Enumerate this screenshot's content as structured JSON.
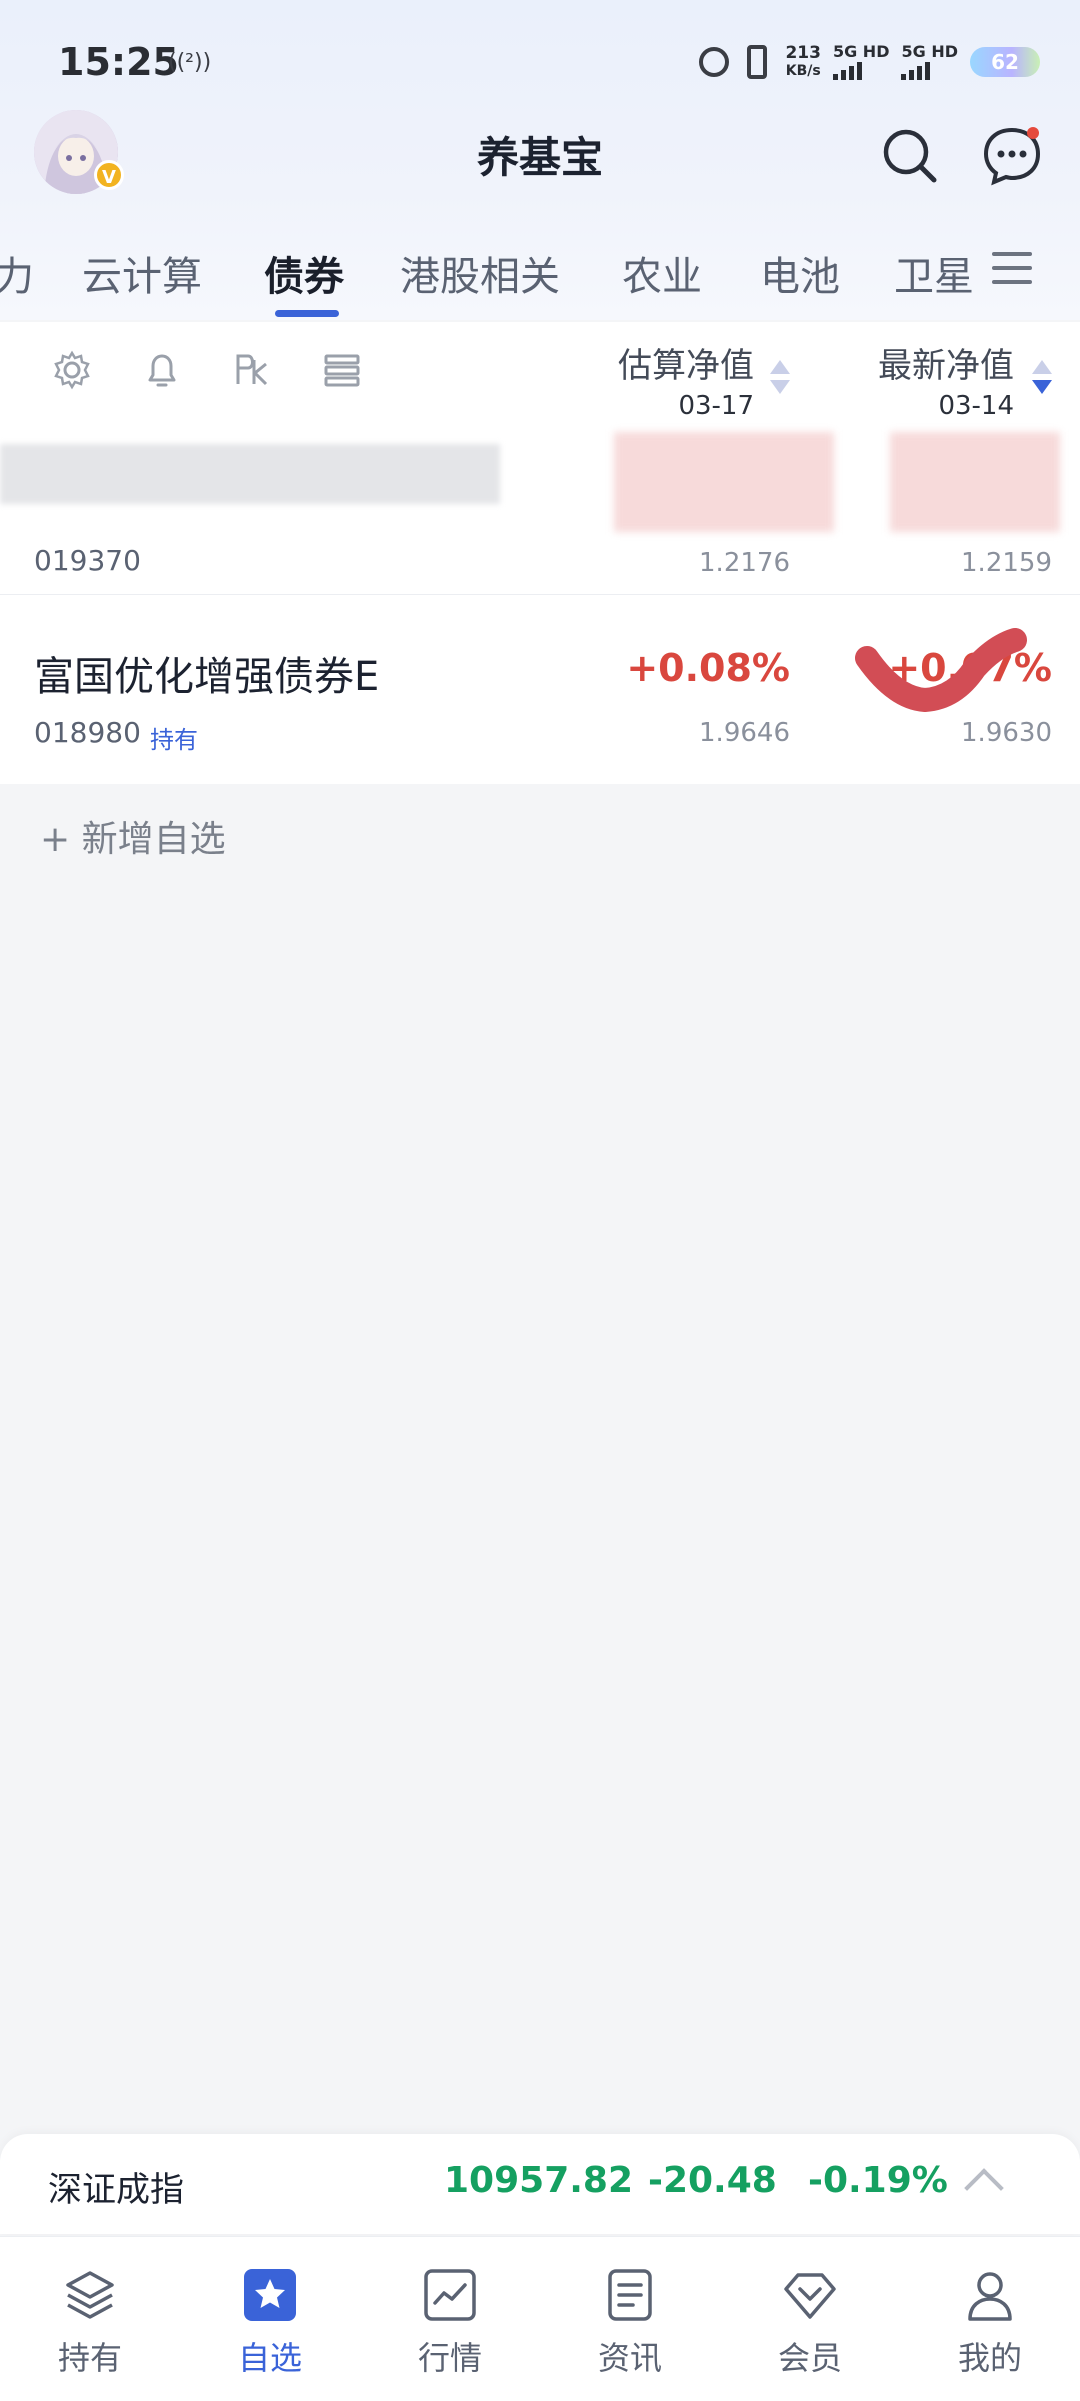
{
  "status_bar": {
    "time": "15:25",
    "signal_label": "((²))",
    "speed_value": "213",
    "speed_unit": "KB/s",
    "net1": "5G HD",
    "net2": "5G HD",
    "battery": "62"
  },
  "header": {
    "title": "养基宝",
    "avatar_badge": "V"
  },
  "tabs": {
    "items": [
      "力",
      "云计算",
      "债券",
      "港股相关",
      "农业",
      "电池",
      "卫星"
    ],
    "active": "债券"
  },
  "table_header": {
    "est_label": "估算净值",
    "est_date": "03-17",
    "last_label": "最新净值",
    "last_date": "03-14"
  },
  "funds": [
    {
      "name": "",
      "code": "019370",
      "tag": "",
      "est_change": "",
      "est_nav": "1.2176",
      "last_change": "",
      "last_nav": "1.2159"
    },
    {
      "name": "富国优化增强债券E",
      "code": "018980",
      "tag": "持有",
      "est_change": "+0.08%",
      "est_nav": "1.9646",
      "last_change": "+0.07%",
      "last_nav": "1.9630"
    }
  ],
  "add_favorite": "+ 新增自选",
  "index_bar": {
    "name": "深证成指",
    "value": "10957.82",
    "change": "-20.48",
    "change_pct": "-0.19%",
    "color": "#15a061"
  },
  "bottom_nav": {
    "items": [
      {
        "label": "持有",
        "icon": "layers-icon"
      },
      {
        "label": "自选",
        "icon": "star-icon"
      },
      {
        "label": "行情",
        "icon": "chart-icon"
      },
      {
        "label": "资讯",
        "icon": "document-icon"
      },
      {
        "label": "会员",
        "icon": "diamond-icon"
      },
      {
        "label": "我的",
        "icon": "user-icon"
      }
    ],
    "active": "自选",
    "accent": "#3a63d8"
  }
}
